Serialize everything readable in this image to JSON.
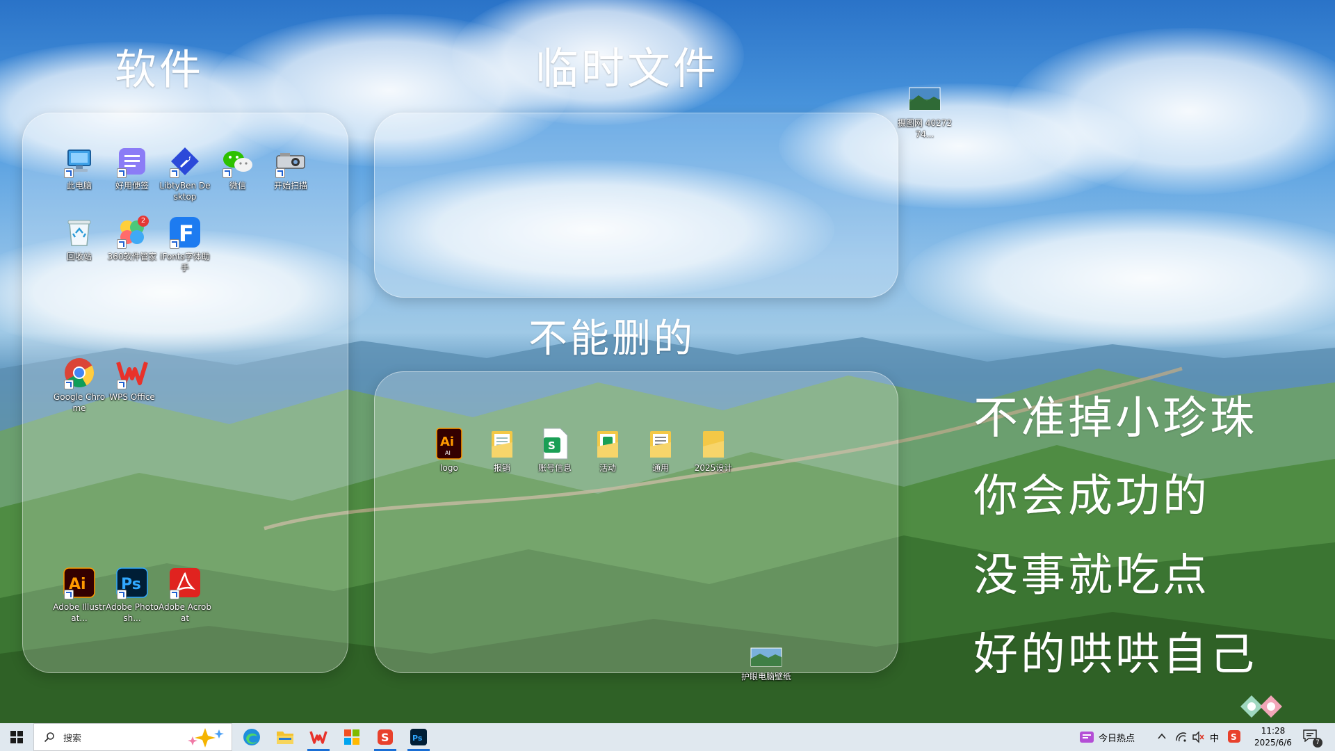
{
  "headings": {
    "software": "软件",
    "temp_files": "临时文件",
    "no_delete": "不能删的"
  },
  "quotes": [
    "不准掉小珍珠",
    "你会成功的",
    "没事就吃点",
    "好的哄哄自己"
  ],
  "desktop": {
    "software_icons": [
      {
        "label": "此电脑",
        "icon": "computer-icon"
      },
      {
        "label": "好用便签",
        "icon": "notes-icon"
      },
      {
        "label": "LibtyBen Desktop",
        "icon": "rocket-icon"
      },
      {
        "label": "微信",
        "icon": "wechat-icon"
      },
      {
        "label": "开始扫描",
        "icon": "scanner-icon"
      },
      {
        "label": "回收站",
        "icon": "recycle-bin-icon"
      },
      {
        "label": "360软件管家",
        "icon": "software-manager-icon",
        "badge": "2"
      },
      {
        "label": "iFonts字体助手",
        "icon": "ifonts-icon"
      },
      {
        "label": "Google Chrome",
        "icon": "chrome-icon"
      },
      {
        "label": "WPS Office",
        "icon": "wps-icon"
      },
      {
        "label": "Adobe Illustrat...",
        "icon": "illustrator-icon"
      },
      {
        "label": "Adobe Photosh...",
        "icon": "photoshop-icon"
      },
      {
        "label": "Adobe Acrobat",
        "icon": "acrobat-icon"
      }
    ],
    "keep_icons": [
      {
        "label": "logo",
        "icon": "ai-file-icon"
      },
      {
        "label": "报销",
        "icon": "folder-icon"
      },
      {
        "label": "账号信息",
        "icon": "spreadsheet-icon"
      },
      {
        "label": "活动",
        "icon": "folder-icon"
      },
      {
        "label": "通用",
        "icon": "folder-icon"
      },
      {
        "label": "2025设计",
        "icon": "folder-icon"
      }
    ],
    "loose_icons": [
      {
        "label": "摄图网 4027274...",
        "icon": "image-file-icon"
      },
      {
        "label": "护眼电脑壁纸",
        "icon": "image-file-icon"
      }
    ]
  },
  "taskbar": {
    "search_placeholder": "搜索",
    "pinned": [
      "edge-icon",
      "file-explorer-icon",
      "wps-icon",
      "windows-store-icon",
      "sogou-icon",
      "photoshop-icon"
    ],
    "news_label": "今日热点",
    "ime_label": "中",
    "time": "11:28",
    "date": "2025/6/6",
    "notification_count": "7",
    "colors": {
      "accent": "#1a6fd6",
      "taskbar_bg": "#dee6ee"
    }
  }
}
